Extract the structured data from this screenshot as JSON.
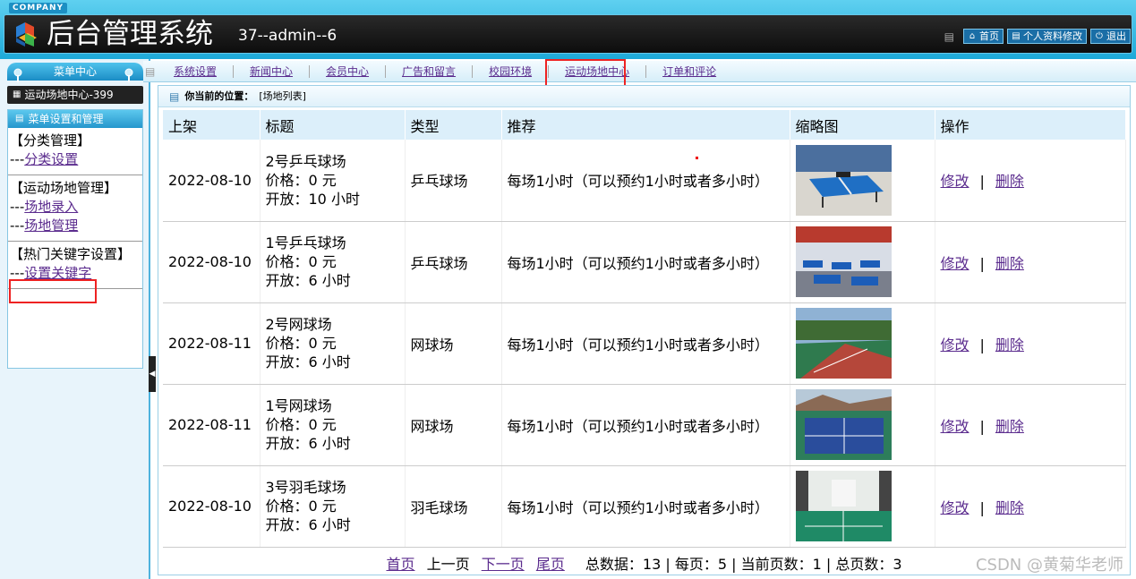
{
  "header": {
    "company": "COMPANY",
    "title": "后台管理系统",
    "user": "37--admin--6",
    "actions": [
      {
        "label": "首页",
        "icon": "home-icon"
      },
      {
        "label": "个人资料修改",
        "icon": "profile-icon"
      },
      {
        "label": "退出",
        "icon": "power-icon"
      }
    ]
  },
  "sidebar": {
    "menu_center": "菜单中心",
    "module": "运动场地中心-399",
    "menu_title": "菜单设置和管理",
    "groups": [
      {
        "title": "【分类管理】",
        "links": [
          {
            "prefix": "---",
            "label": "分类设置"
          }
        ]
      },
      {
        "title": "【运动场地管理】",
        "links": [
          {
            "prefix": "---",
            "label": "场地录入"
          },
          {
            "prefix": "---",
            "label": "场地管理"
          }
        ]
      },
      {
        "title": "【热门关键字设置】",
        "links": [
          {
            "prefix": "---",
            "label": "设置关键字"
          }
        ]
      }
    ]
  },
  "nav": {
    "items": [
      "系统设置",
      "新闻中心",
      "会员中心",
      "广告和留言",
      "校园环境",
      "运动场地中心",
      "订单和评论"
    ]
  },
  "location": {
    "prefix": "你当前的位置：",
    "path": "[场地列表]"
  },
  "table": {
    "headers": [
      "上架",
      "标题",
      "类型",
      "推荐",
      "缩略图",
      "操作"
    ],
    "rows": [
      {
        "date": "2022-08-10",
        "name": "2号乒乓球场",
        "price": "价格：0 元",
        "open": "开放：10 小时",
        "type": "乒乓球场",
        "recommend": "每场1小时（可以预约1小时或者多小时）",
        "thumb": "table-tennis-outdoor",
        "edit": "修改",
        "sep": "|",
        "delete": "删除"
      },
      {
        "date": "2022-08-10",
        "name": "1号乒乓球场",
        "price": "价格：0 元",
        "open": "开放：6 小时",
        "type": "乒乓球场",
        "recommend": "每场1小时（可以预约1小时或者多小时）",
        "thumb": "table-tennis-indoor",
        "edit": "修改",
        "sep": "|",
        "delete": "删除"
      },
      {
        "date": "2022-08-11",
        "name": "2号网球场",
        "price": "价格：0 元",
        "open": "开放：6 小时",
        "type": "网球场",
        "recommend": "每场1小时（可以预约1小时或者多小时）",
        "thumb": "tennis-court-red",
        "edit": "修改",
        "sep": "|",
        "delete": "删除"
      },
      {
        "date": "2022-08-11",
        "name": "1号网球场",
        "price": "价格：0 元",
        "open": "开放：6 小时",
        "type": "网球场",
        "recommend": "每场1小时（可以预约1小时或者多小时）",
        "thumb": "tennis-court-blue",
        "edit": "修改",
        "sep": "|",
        "delete": "删除"
      },
      {
        "date": "2022-08-10",
        "name": "3号羽毛球场",
        "price": "价格：0 元",
        "open": "开放：6 小时",
        "type": "羽毛球场",
        "recommend": "每场1小时（可以预约1小时或者多小时）",
        "thumb": "badminton-court",
        "edit": "修改",
        "sep": "|",
        "delete": "删除"
      }
    ]
  },
  "pager": {
    "first": "首页",
    "prev": "上一页",
    "next": "下一页",
    "last": "尾页",
    "summary": "总数据：13 | 每页：5 | 当前页数：1 | 总页数：3"
  },
  "watermark": "CSDN @黄菊华老师"
}
